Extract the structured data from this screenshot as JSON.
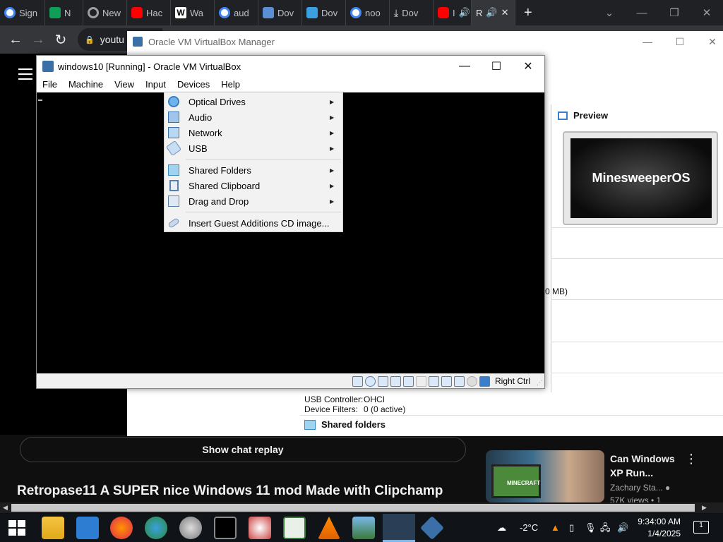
{
  "browser": {
    "tabs": [
      {
        "label": "Sign",
        "color": "#4285f4"
      },
      {
        "label": "N",
        "color": "#0f9d58"
      },
      {
        "label": "New",
        "color": "#9aa0a6"
      },
      {
        "label": "Hac",
        "color": "#ff0000"
      },
      {
        "label": "Wa",
        "color": "#ffffff"
      },
      {
        "label": "aud",
        "color": "#4285f4"
      },
      {
        "label": "Dov",
        "color": "#5b8fd4"
      },
      {
        "label": "Dov",
        "color": "#3aa0e0"
      },
      {
        "label": "noo",
        "color": "#4285f4"
      },
      {
        "label": "Dov",
        "color": "#e8eaed"
      },
      {
        "label": "I",
        "color": "#ff0000"
      },
      {
        "label": "R",
        "color": "#9aa0a6"
      }
    ],
    "address_text": "youtu"
  },
  "youtube": {
    "chat_replay": "Show chat replay",
    "video_title": "Retropase11 A SUPER nice Windows 11 mod Made with Clipchamp",
    "rec_title": "Can Windows XP Run...",
    "rec_channel": "Zachary Sta...",
    "rec_views": "57K views • 1",
    "rec_thumb_text": "MINECRAFT"
  },
  "vbox_manager": {
    "title": "Oracle VM VirtualBox Manager",
    "preview_label": "Preview",
    "preview_vm_name": "MinesweeperOS",
    "fragment_text": "0 MB)",
    "usb_controller_key": "USB Controller:",
    "usb_controller_val": "OHCI",
    "device_filters_key": "Device Filters:",
    "device_filters_val": "0 (0 active)",
    "shared_folders_head": "Shared folders"
  },
  "vm_window": {
    "title": "windows10 [Running] - Oracle VM VirtualBox",
    "menu": [
      "File",
      "Machine",
      "View",
      "Input",
      "Devices",
      "Help"
    ],
    "host_key": "Right Ctrl"
  },
  "devices_menu": {
    "items": [
      {
        "label": "Optical Drives",
        "icon": "optical-disc-icon",
        "submenu": true
      },
      {
        "label": "Audio",
        "icon": "audio-icon",
        "submenu": true
      },
      {
        "label": "Network",
        "icon": "network-icon",
        "submenu": true
      },
      {
        "label": "USB",
        "icon": "usb-icon",
        "submenu": true
      },
      {
        "label": "Shared Folders",
        "icon": "shared-folder-icon",
        "submenu": true
      },
      {
        "label": "Shared Clipboard",
        "icon": "clipboard-icon",
        "submenu": true
      },
      {
        "label": "Drag and Drop",
        "icon": "drag-drop-icon",
        "submenu": true
      },
      {
        "label": "Insert Guest Additions CD image...",
        "icon": "guest-additions-icon",
        "submenu": false
      }
    ]
  },
  "taskbar": {
    "temperature": "-2°C",
    "time": "9:34:00 AM",
    "date": "1/4/2025",
    "notification_count": "1"
  }
}
